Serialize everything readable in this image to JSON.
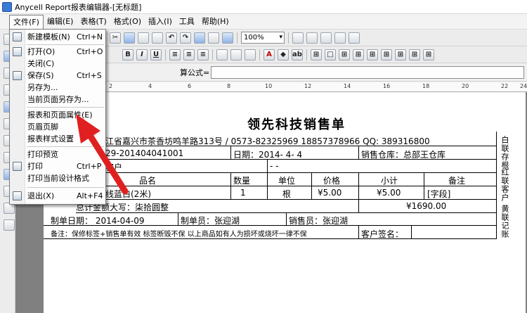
{
  "window": {
    "title": "Anycell Report报表编辑器-[无标题]"
  },
  "menubar": [
    {
      "label": "文件(F)"
    },
    {
      "label": "编辑(E)"
    },
    {
      "label": "表格(T)"
    },
    {
      "label": "格式(O)"
    },
    {
      "label": "插入(I)"
    },
    {
      "label": "工具"
    },
    {
      "label": "帮助(H)"
    }
  ],
  "toolbar": {
    "zoom": "100%",
    "formula_label": "算公式="
  },
  "file_menu": [
    {
      "label": "新建模板(N)",
      "shortcut": "Ctrl+N",
      "icon": "new-document-icon"
    },
    {
      "label": "打开(O)",
      "shortcut": "Ctrl+O",
      "icon": "folder-open-icon"
    },
    {
      "label": "关闭(C)",
      "shortcut": "",
      "icon": ""
    },
    {
      "label": "保存(S)",
      "shortcut": "Ctrl+S",
      "icon": "save-disk-icon"
    },
    {
      "label": "另存为...",
      "shortcut": "",
      "icon": ""
    },
    {
      "label": "当前页面另存为...",
      "shortcut": "",
      "icon": ""
    },
    {
      "label": "报表和页面属性(E)",
      "shortcut": "",
      "icon": ""
    },
    {
      "label": "页眉页脚",
      "shortcut": "",
      "icon": ""
    },
    {
      "label": "报表样式设置",
      "shortcut": "",
      "icon": ""
    },
    {
      "label": "打印预览",
      "shortcut": "",
      "icon": ""
    },
    {
      "label": "打印",
      "shortcut": "Ctrl+P",
      "icon": "printer-icon"
    },
    {
      "label": "打印当前设计格式",
      "shortcut": "",
      "icon": ""
    },
    {
      "label": "退出(X)",
      "shortcut": "Alt+F4",
      "icon": "exit-door-icon"
    }
  ],
  "ruler": [
    "2",
    "4",
    "6",
    "8",
    "10",
    "12",
    "14",
    "16",
    "18",
    "20",
    "22",
    "24"
  ],
  "report": {
    "title": "领先科技销售单",
    "address": "江省嘉兴市茶香坊鸣羊路313号 / 0573-82325969 18857378966 QQ: 389316800",
    "order_no": "29-201404041001",
    "date_label": "日期：2014- 4- 4",
    "warehouse": "销售仓库：总部王仓库",
    "customer": "客户",
    "customer_value": "- -",
    "headers": {
      "name": "品名",
      "qty": "数量",
      "unit": "单位",
      "price": "价格",
      "subtotal": "小计",
      "note": "备注"
    },
    "row": {
      "name": "线蓝白(2米)",
      "qty": "1",
      "unit": "根",
      "price": "¥5.00",
      "subtotal": "¥5.00",
      "note": "[字段]"
    },
    "total_label": "总计金额大写：柒拾圆整",
    "total_value": "¥1690.00",
    "made_date": "制单日期： 2014-04-09",
    "maker": "制单员：张迎湖",
    "salesman": "销售员：张迎湖",
    "remark": "备注：保修标签+销售单有效 标签断毁不保 以上商品如有人为损坏或烧坏一律不保",
    "sign": "客户签名：",
    "side_labels": [
      "白联存根",
      "红联客户",
      "黄联记账"
    ]
  }
}
